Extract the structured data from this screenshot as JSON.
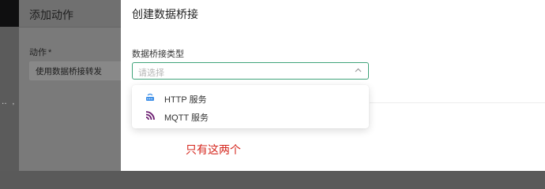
{
  "under_drawer": {
    "title": "添加动作",
    "field_label": "动作",
    "required_mark": "*",
    "select_value": "使用数据桥接转发",
    "backdrop_dots": "‥ , ‥"
  },
  "drawer": {
    "title": "创建数据桥接",
    "field_label": "数据桥接类型",
    "select": {
      "placeholder": "请选择",
      "accent_color": "#3fa37a"
    },
    "options": [
      {
        "label": "HTTP 服务",
        "icon": "http-icon",
        "icon_color": "#3b8ee8"
      },
      {
        "label": "MQTT 服务",
        "icon": "mqtt-icon",
        "icon_color": "#6a1b6f"
      }
    ]
  },
  "annotation": {
    "text": "只有这两个",
    "color": "#d5271e"
  }
}
